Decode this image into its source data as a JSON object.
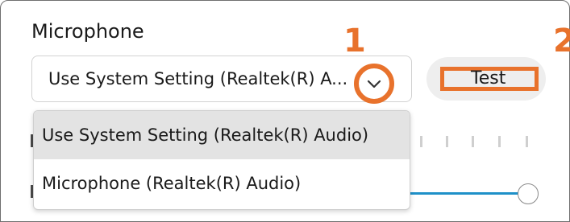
{
  "section": {
    "title": "Microphone"
  },
  "select": {
    "value": "Use System Setting (Realtek(R) A...",
    "chevron_icon": "chevron-down-icon"
  },
  "annotations": {
    "marker_1": "1",
    "marker_2": "2",
    "color": "#e8722c"
  },
  "test_button": {
    "label": "Test"
  },
  "dropdown": {
    "options": [
      {
        "label": "Use System Setting (Realtek(R) Audio)",
        "selected": true
      },
      {
        "label": "Microphone (Realtek(R) Audio)",
        "selected": false
      }
    ]
  },
  "slider": {
    "accent": "#1e90c8",
    "level": 1.0
  }
}
